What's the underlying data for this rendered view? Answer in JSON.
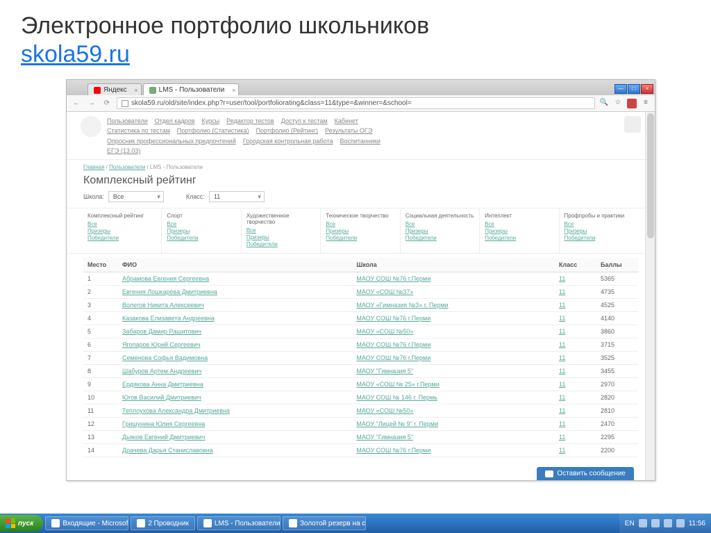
{
  "slide": {
    "title": "Электронное портфолио школьников",
    "link": "skola59.ru"
  },
  "browser": {
    "tabs": [
      {
        "label": "Яндекс"
      },
      {
        "label": "LMS - Пользователи"
      }
    ],
    "url": "skola59.ru/old/site/index.php?r=user/tool/portfoliorating&class=11&type=&winner=&school="
  },
  "topmenu": {
    "row1": [
      "Пользователи",
      "Отдел кадров",
      "Курсы",
      "Редактор тестов",
      "Доступ к тестам",
      "Кабинет"
    ],
    "row2": [
      "Статистика по тестам",
      "Портфолио (Статистика)",
      "Портфолио (Рейтинг)",
      "Результаты ОГЭ"
    ],
    "row3": [
      "Опросник профессиональных предпочтений",
      "Городская контрольная работа",
      "Воспитанники"
    ],
    "row4": [
      "ЕГЭ (13.03)"
    ]
  },
  "breadcrumb": {
    "home": "Главная",
    "mid": "Пользователи",
    "last": "LMS - Пользователи"
  },
  "page_title": "Комплексный рейтинг",
  "filters": {
    "school_label": "Школа:",
    "school_value": "Все",
    "class_label": "Класс:",
    "class_value": "11"
  },
  "categories": [
    {
      "title": "Комплексный рейтинг",
      "links": [
        "Все",
        "Призеры",
        "Победители"
      ]
    },
    {
      "title": "Спорт",
      "links": [
        "Все",
        "Призеры",
        "Победители"
      ]
    },
    {
      "title": "Художественное творчество",
      "links": [
        "Все",
        "Призеры",
        "Победители"
      ]
    },
    {
      "title": "Техническое творчество",
      "links": [
        "Все",
        "Призеры",
        "Победители"
      ]
    },
    {
      "title": "Социальная деятельность",
      "links": [
        "Все",
        "Призеры",
        "Победители"
      ]
    },
    {
      "title": "Интеллект",
      "links": [
        "Все",
        "Призеры",
        "Победители"
      ]
    },
    {
      "title": "Профпробы и практики",
      "links": [
        "Все",
        "Призеры",
        "Победители"
      ]
    }
  ],
  "table": {
    "headers": {
      "place": "Место",
      "fio": "ФИО",
      "school": "Школа",
      "class": "Класс",
      "score": "Баллы"
    },
    "rows": [
      {
        "place": "1",
        "fio": "Абрамова Евгения Сергеевна",
        "school": "МАОУ СОШ №76 г.Перми",
        "class": "11",
        "score": "5365"
      },
      {
        "place": "2",
        "fio": "Евгения Лошкарёва Дмитриевна",
        "school": "МАОУ «СОШ №37»",
        "class": "11",
        "score": "4735"
      },
      {
        "place": "3",
        "fio": "Волегов Никита Алексеевич",
        "school": "МАОУ «Гимназия №3» г. Перми",
        "class": "11",
        "score": "4525"
      },
      {
        "place": "4",
        "fio": "Казакова Елизавета Андреевна",
        "school": "МАОУ СОШ №76 г.Перми",
        "class": "11",
        "score": "4140"
      },
      {
        "place": "5",
        "fio": "Забаров Дамир Рашитович",
        "school": "МАОУ «СОШ №50»",
        "class": "11",
        "score": "3860"
      },
      {
        "place": "6",
        "fio": "Ягопаров Юрий Сергеевич",
        "school": "МАОУ СОШ №76 г.Перми",
        "class": "11",
        "score": "3715"
      },
      {
        "place": "7",
        "fio": "Семенова Софья Вадимовна",
        "school": "МАОУ СОШ №76 г.Перми",
        "class": "11",
        "score": "3525"
      },
      {
        "place": "8",
        "fio": "Шабуров Артем Андреевич",
        "school": "МАОУ \"Гимназия 5\"",
        "class": "11",
        "score": "3455"
      },
      {
        "place": "9",
        "fio": "Ердякова Анна Дмитриевна",
        "school": "МАОУ «СОШ № 25» г.Перми",
        "class": "11",
        "score": "2970"
      },
      {
        "place": "10",
        "fio": "Югов Василий Дмитриевич",
        "school": "МАОУ СОШ № 146 г. Пермь",
        "class": "11",
        "score": "2820"
      },
      {
        "place": "11",
        "fio": "Теплоухова Александра Дмитриевна",
        "school": "МАОУ «СОШ №50»",
        "class": "11",
        "score": "2810"
      },
      {
        "place": "12",
        "fio": "Гришунина Юлия Сергеевна",
        "school": "МАОУ \"Лицей № 9\" г. Перми",
        "class": "11",
        "score": "2470"
      },
      {
        "place": "13",
        "fio": "Дьяков Евгений Дмитриевич",
        "school": "МАОУ \"Гимназия 5\"",
        "class": "11",
        "score": "2295"
      },
      {
        "place": "14",
        "fio": "Драчева Дарья Станиславовна",
        "school": "МАОУ СОШ №76 г.Перми",
        "class": "11",
        "score": "2200"
      }
    ]
  },
  "chat_widget": "Оставить сообщение",
  "taskbar": {
    "start": "пуск",
    "items": [
      "Входящие - Microsof...",
      "2 Проводник",
      "LMS - Пользователи...",
      "Золотой резерв на с..."
    ],
    "lang": "EN",
    "time": "11:56"
  }
}
